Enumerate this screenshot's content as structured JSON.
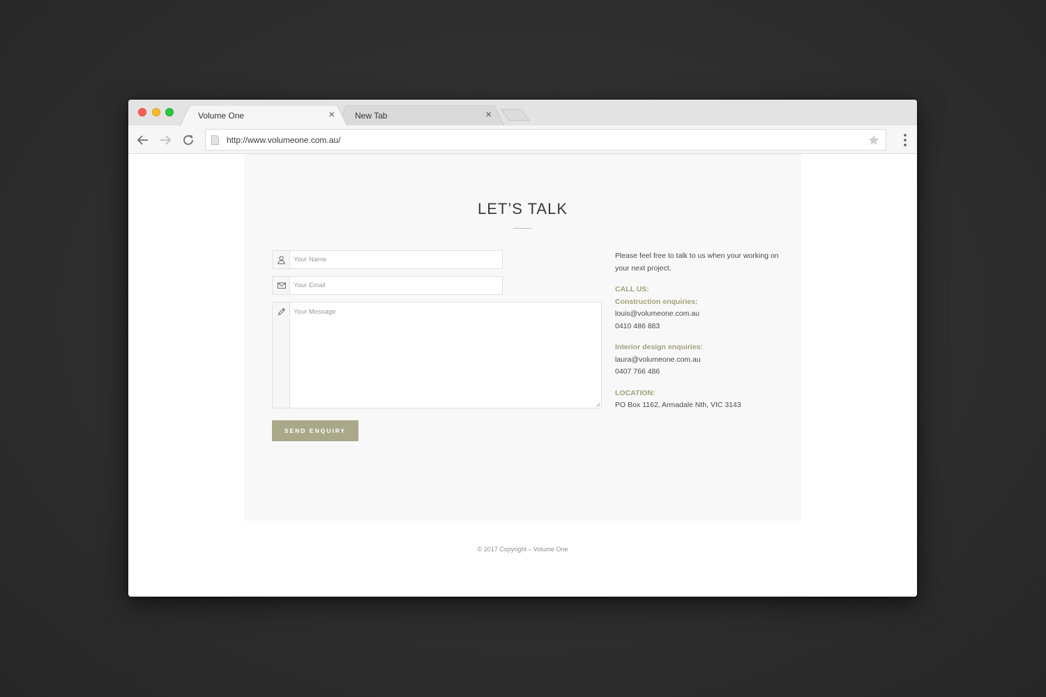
{
  "browser": {
    "tabs": [
      {
        "label": "Volume One",
        "close": "×",
        "active": true
      },
      {
        "label": "New Tab",
        "close": "×",
        "active": false
      }
    ],
    "url": "http://www.volumeone.com.au/",
    "icons": {
      "back": "arrow-left-icon",
      "forward": "arrow-right-icon",
      "reload": "reload-icon",
      "page": "page-icon",
      "bookmark": "star-icon",
      "menu": "kebab-menu-icon"
    }
  },
  "page": {
    "title": "LET’S TALK",
    "form": {
      "name_placeholder": "Your Name",
      "email_placeholder": "Your Email",
      "message_placeholder": "Your Message",
      "name_value": "",
      "email_value": "",
      "message_value": "",
      "submit_label": "SEND ENQUIRY"
    },
    "contact": {
      "intro": "Please feel free to talk to us when your working on your next project.",
      "call_heading": "CALL US:",
      "construction_heading": "Construction enquiries:",
      "construction_email": "louis@volumeone.com.au",
      "construction_phone": "0410 486 883",
      "interior_heading": "Interior design enquiries:",
      "interior_email": "laura@volumeone.com.au",
      "interior_phone": "0407 766 486",
      "location_heading": "LOCATION:",
      "location_address": "PO Box 1162, Armadale Nth, VIC 3143"
    },
    "footer": "© 2017 Copyright – Volume One"
  },
  "colors": {
    "accent": "#a2a07a",
    "button": "#a9a98a",
    "panel": "#f8f8f8",
    "desk": "#2e2e2e"
  }
}
